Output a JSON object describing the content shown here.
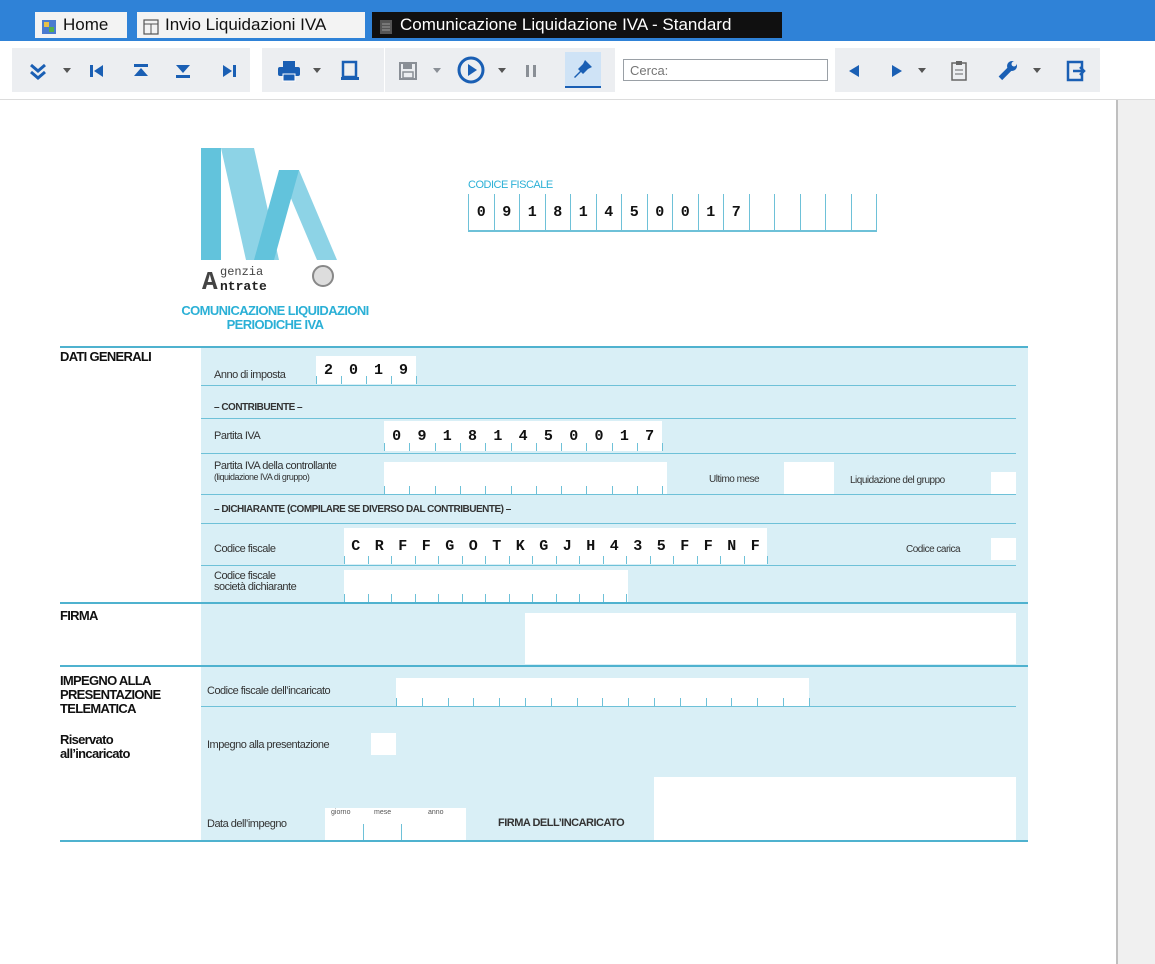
{
  "tabs": [
    {
      "label": "Home",
      "icon": "home-icon"
    },
    {
      "label": "Invio Liquidazioni IVA",
      "icon": "list-icon"
    },
    {
      "label": "Comunicazione Liquidazione IVA - Standard",
      "icon": "document-icon"
    }
  ],
  "toolbar": {
    "search_placeholder": "Cerca:"
  },
  "form": {
    "logo_text": "IVA",
    "agency_line1": "genzia",
    "agency_line2": "ntrate",
    "agency_initial": "A",
    "form_title_line1": "COMUNICAZIONE LIQUIDAZIONI",
    "form_title_line2": "PERIODICHE IVA",
    "codice_fiscale_label": "CODICE FISCALE",
    "codice_fiscale_value": [
      "0",
      "9",
      "1",
      "8",
      "1",
      "4",
      "5",
      "0",
      "0",
      "1",
      "7"
    ],
    "dati_generali": "DATI GENERALI",
    "anno_label": "Anno di imposta",
    "anno_value": [
      "2",
      "0",
      "1",
      "9"
    ],
    "contribuente_header": "– CONTRIBUENTE –",
    "partita_iva_label": "Partita IVA",
    "partita_iva_value": [
      "0",
      "9",
      "1",
      "8",
      "1",
      "4",
      "5",
      "0",
      "0",
      "1",
      "7"
    ],
    "partita_controllante_label1": "Partita IVA della controllante",
    "partita_controllante_label2": "(liquidazione IVA di gruppo)",
    "ultimo_mese_label": "Ultimo mese",
    "liquidazione_gruppo_label": "Liquidazione del gruppo",
    "dichiarante_header": "– DICHIARANTE (COMPILARE SE DIVERSO DAL CONTRIBUENTE) –",
    "codice_fiscale_dich_label": "Codice fiscale",
    "codice_fiscale_dich_value": [
      "C",
      "R",
      "F",
      "F",
      "G",
      "O",
      "T",
      "K",
      "G",
      "J",
      "H",
      "4",
      "3",
      "5",
      "F",
      "F",
      "N",
      "F"
    ],
    "codice_carica_label": "Codice carica",
    "cf_societa_label1": "Codice fiscale",
    "cf_societa_label2": "società dichiarante",
    "firma": "FIRMA",
    "impegno_header1": "IMPEGNO ALLA",
    "impegno_header2": "PRESENTAZIONE",
    "impegno_header3": "TELEMATICA",
    "riservato1": "Riservato",
    "riservato2": "all’incaricato",
    "cf_incaricato_label": "Codice fiscale dell’incaricato",
    "impegno_presentazione_label": "Impegno alla presentazione",
    "data_impegno_label": "Data dell’impegno",
    "giorno": "giorno",
    "mese": "mese",
    "anno": "anno",
    "firma_incaricato": "FIRMA DELL’INCARICATO"
  }
}
